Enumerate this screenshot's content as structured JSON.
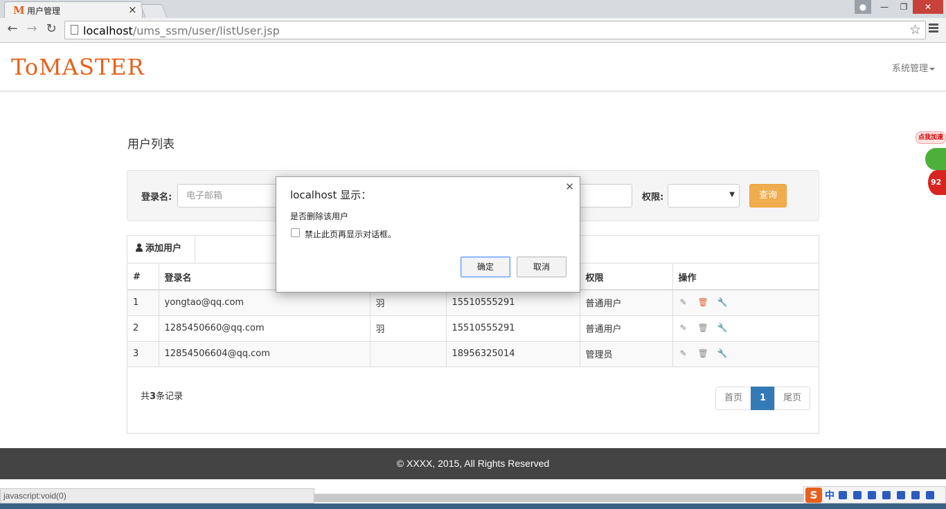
{
  "browser": {
    "tab_title": "用户管理",
    "tab_favicon": "M",
    "url_host": "localhost",
    "url_path": "/ums_ssm/user/listUser.jsp",
    "status_text": "javascript:void(0)"
  },
  "app": {
    "logo": "ToMASTER",
    "system_menu": "系统管理",
    "page_title": "用户列表"
  },
  "search": {
    "login_label": "登录名:",
    "login_placeholder": "电子邮箱",
    "role_label": "权限:",
    "role_value": "",
    "query_button": "查询"
  },
  "toolbar": {
    "add_user": "添加用户"
  },
  "table": {
    "headers": [
      "#",
      "登录名",
      "",
      "",
      "权限",
      "操作"
    ],
    "rows": [
      {
        "no": "1",
        "login": "yongtao@qq.com",
        "name": "羽",
        "phone": "15510555291",
        "role": "普通用户"
      },
      {
        "no": "2",
        "login": "1285450660@qq.com",
        "name": "羽",
        "phone": "15510555291",
        "role": "普通用户"
      },
      {
        "no": "3",
        "login": "12854506604@qq.com",
        "name": "",
        "phone": "18956325014",
        "role": "管理员"
      }
    ]
  },
  "summary": {
    "prefix": "共",
    "count": "3",
    "suffix": "条记录"
  },
  "pagination": {
    "first": "首页",
    "current": "1",
    "last": "尾页"
  },
  "footer": {
    "copyright": "© XXXX, 2015, All Rights Reserved"
  },
  "dialog": {
    "title": "localhost 显示：",
    "message": "是否删除该用户",
    "checkbox_label": "禁止此页再显示对话框。",
    "ok": "确定",
    "cancel": "取消"
  },
  "widget": {
    "bubble": "点我加速",
    "badge": "92"
  },
  "ime": {
    "logo": "S",
    "mode": "中"
  },
  "colors": {
    "brand": "#e8601c",
    "primary": "#337ab7",
    "warning": "#f0ad4e",
    "footer_bg": "#444444"
  }
}
